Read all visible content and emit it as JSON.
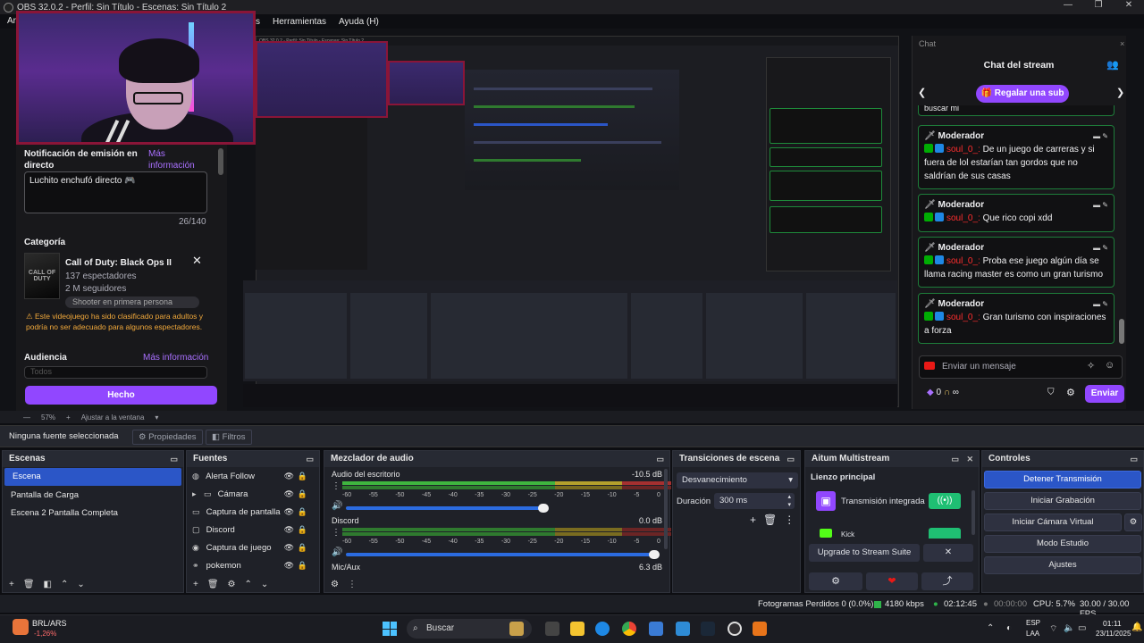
{
  "window": {
    "title": "OBS 32.0.2 - Perfil: Sin Título - Escenas: Sin Título 2",
    "menu_first": "Ar",
    "menu": [
      "s",
      "Herramientas",
      "Ayuda (H)"
    ]
  },
  "twitch_manager": {
    "notification_title": "Notificación de emisión en directo",
    "notification_more": "Más información",
    "notification_text": "Luchito enchufó directo",
    "notification_count": "26/140",
    "category_title": "Categoría",
    "category_game": "Call of Duty: Black Ops II",
    "category_img_text": "CALL OF DUTY",
    "category_viewers": "137 espectadores",
    "category_followers": "2 M seguidores",
    "category_tag": "Shooter en primera persona",
    "category_warning": "Este videojuego ha sido clasificado para adultos y podría no ser adecuado para algunos espectadores.",
    "audience_title": "Audiencia",
    "audience_more": "Más información",
    "audience_value": "Todos",
    "done_button": "Hecho"
  },
  "chat": {
    "label": "Chat",
    "title": "Chat del stream",
    "sub_button": "Regalar una sub",
    "partial_top": "buscar mi",
    "messages": [
      {
        "role": "Moderador",
        "user": "soul_0_:",
        "text": "De un juego de carreras y si fuera de lol estarían tan gordos que no saldrían de sus casas"
      },
      {
        "role": "Moderador",
        "user": "soul_0_:",
        "text": "Que rico copi xdd"
      },
      {
        "role": "Moderador",
        "user": "soul_0_:",
        "text": "Proba ese juego algún día se llama racing master es como un gran turismo"
      },
      {
        "role": "Moderador",
        "user": "soul_0_:",
        "text": "Gran turismo con inspiraciones a forza"
      }
    ],
    "input_placeholder": "Enviar un mensaje",
    "points": "0",
    "send_button": "Enviar"
  },
  "zoom": {
    "value": "57%",
    "fit_label": "Ajustar a la ventana"
  },
  "source_toolbar": {
    "no_selection": "Ninguna fuente seleccionada",
    "properties": "Propiedades",
    "filters": "Filtros"
  },
  "scenes": {
    "title": "Escenas",
    "items": [
      "Escena",
      "Pantalla de Carga",
      "Escena 2 Pantalla Completa"
    ]
  },
  "sources": {
    "title": "Fuentes",
    "items": [
      {
        "name": "Alerta Follow",
        "icon": "browser-icon"
      },
      {
        "name": "Cámara",
        "icon": "folder-icon"
      },
      {
        "name": "Captura de pantalla",
        "icon": "monitor-icon"
      },
      {
        "name": "Discord",
        "icon": "window-icon"
      },
      {
        "name": "Captura de juego",
        "icon": "gamepad-icon"
      },
      {
        "name": "pokemon",
        "icon": "link-icon"
      }
    ]
  },
  "mixer": {
    "title": "Mezclador de audio",
    "channels": [
      {
        "name": "Audio del escritorio",
        "db": "-10.5 dB",
        "level_percent": 96
      },
      {
        "name": "Discord",
        "db": "0.0 dB",
        "level_percent": 100
      },
      {
        "name": "Mic/Aux",
        "db": "6.3 dB",
        "level_percent": 100
      }
    ],
    "scale": [
      "-60",
      "-55",
      "-50",
      "-45",
      "-40",
      "-35",
      "-30",
      "-25",
      "-20",
      "-15",
      "-10",
      "-5",
      "0"
    ]
  },
  "transitions": {
    "title": "Transiciones de escena",
    "selected": "Desvanecimiento",
    "duration_label": "Duración",
    "duration_value": "300 ms"
  },
  "multistream": {
    "title": "Aitum Multistream",
    "canvas_label": "Lienzo principal",
    "outputs": [
      "Transmisión integrada",
      "Kick"
    ],
    "upgrade_button": "Upgrade to Stream Suite"
  },
  "controls": {
    "title": "Controles",
    "buttons": [
      "Detener Transmisión",
      "Iniciar Grabación",
      "Iniciar Cámara Virtual",
      "Modo Estudio",
      "Ajustes"
    ]
  },
  "status": {
    "dropped_frames": "Fotogramas Perdidos 0 (0.0%)",
    "bitrate": "4180 kbps",
    "stream_time": "02:12:45",
    "rec_time": "00:00:00",
    "cpu": "CPU: 5.7%",
    "fps": "30.00 / 30.00 FPS"
  },
  "taskbar": {
    "stock_ticker": "BRL/ARS",
    "stock_change": "-1,26%",
    "search_placeholder": "Buscar",
    "lang": "ESP",
    "lang2": "LAA",
    "time": "01:11",
    "date": "23/11/2025"
  },
  "colors": {
    "twitch_purple": "#9147ff",
    "obs_selected": "#2b56c7",
    "mod_border": "#1e7d3a",
    "username": "#ff2e2e"
  }
}
